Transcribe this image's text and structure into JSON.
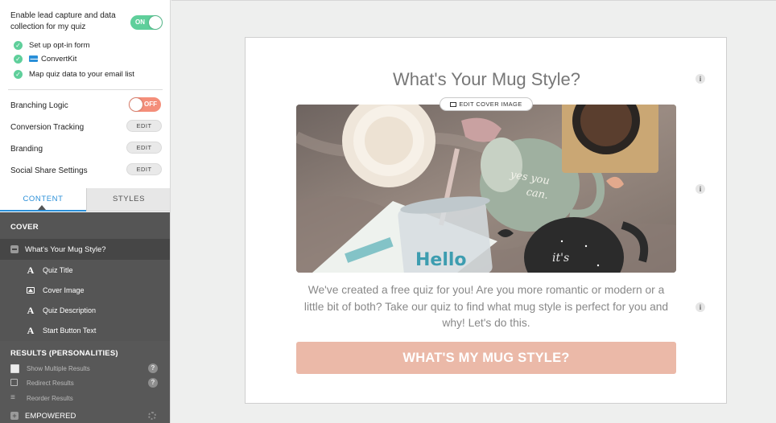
{
  "lead_capture": {
    "label": "Enable lead capture and data collection for my quiz",
    "toggle": "ON",
    "checklist": [
      "Set up opt-in form",
      "ConvertKit",
      "Map quiz data to your email list"
    ]
  },
  "settings": {
    "branching": {
      "label": "Branching Logic",
      "toggle": "OFF"
    },
    "conversion": {
      "label": "Conversion Tracking",
      "button": "EDIT"
    },
    "branding": {
      "label": "Branding",
      "button": "EDIT"
    },
    "social": {
      "label": "Social Share Settings",
      "button": "EDIT"
    }
  },
  "tabs": {
    "content": "CONTENT",
    "styles": "STYLES"
  },
  "cover": {
    "heading": "COVER",
    "item": "What's Your Mug Style?",
    "subitems": [
      "Quiz Title",
      "Cover Image",
      "Quiz Description",
      "Start Button Text"
    ]
  },
  "results": {
    "heading": "RESULTS (PERSONALITIES)",
    "options": [
      "Show Multiple Results",
      "Redirect Results",
      "Reorder Results"
    ],
    "first": "EMPOWERED"
  },
  "quiz": {
    "title": "What's Your Mug Style?",
    "edit_cover": "EDIT COVER IMAGE",
    "description": "We've created a free quiz for you! Are you more romantic or modern or a little bit of both? Take our quiz to find what mug style is perfect for you and why! Let's do this.",
    "start_button": "WHAT'S MY MUG STYLE?",
    "info_icon": "i"
  },
  "colors": {
    "accent": "#2a8fd8",
    "toggle_on": "#5fcf9b",
    "toggle_off": "#f48e7a",
    "start_button": "#ebb9a8"
  },
  "icons": {
    "check": "check-circle-icon",
    "convertkit": "mail-icon",
    "info": "info-icon",
    "help": "question-icon",
    "gear": "gear-icon"
  }
}
